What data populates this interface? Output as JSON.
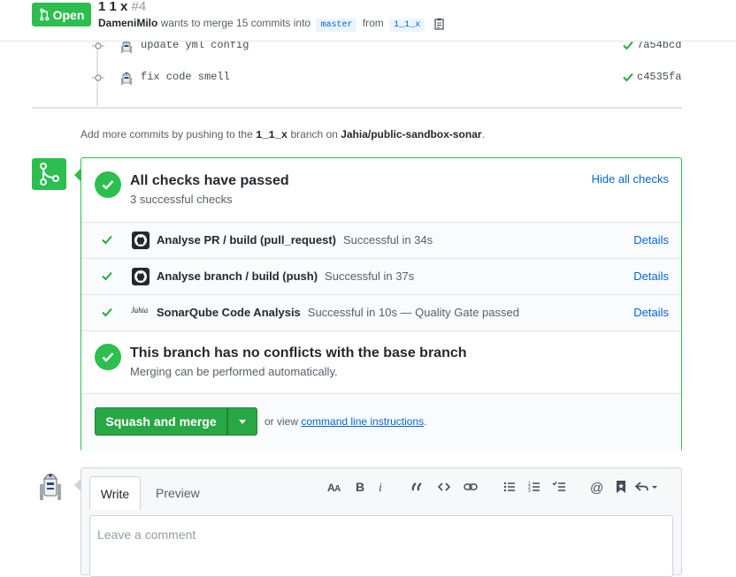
{
  "header": {
    "state": "Open",
    "title": "1 1 x",
    "number": "#4",
    "author": "DameniMilo",
    "meta_text": "wants to merge 15 commits into",
    "base_branch": "master",
    "from_text": "from",
    "head_branch": "1_1_x"
  },
  "commits": [
    {
      "message": "update yml config",
      "sha": "7a54bcd"
    },
    {
      "message": "fix code smell",
      "sha": "c4535fa"
    }
  ],
  "push_hint": {
    "prefix": "Add more commits by pushing to the",
    "branch": "1_1_x",
    "middle": "branch on",
    "repo": "Jahia/public-sandbox-sonar",
    "suffix": "."
  },
  "checks": {
    "title": "All checks have passed",
    "subtitle": "3 successful checks",
    "hide_label": "Hide all checks",
    "items": [
      {
        "name": "Analyse PR / build (pull_request)",
        "status": "Successful in 34s",
        "details": "Details",
        "icon": "github-icon"
      },
      {
        "name": "Analyse branch / build (push)",
        "status": "Successful in 37s",
        "details": "Details",
        "icon": "github-icon"
      },
      {
        "name": "SonarQube Code Analysis",
        "status": "Successful in 10s — Quality Gate passed",
        "details": "Details",
        "icon": "jahia-logo",
        "logo_text": "Jahia"
      }
    ]
  },
  "conflicts": {
    "title": "This branch has no conflicts with the base branch",
    "subtitle": "Merging can be performed automatically."
  },
  "merge": {
    "button_label": "Squash and merge",
    "or_view": "or view",
    "cli_link": "command line instructions",
    "cli_suffix": "."
  },
  "comment": {
    "tab_write": "Write",
    "tab_preview": "Preview",
    "placeholder": "Leave a comment",
    "toolbar": [
      "text-size-icon",
      "bold-icon",
      "italic-icon",
      "quote-icon",
      "code-icon",
      "link-icon",
      "bullet-list-icon",
      "numbered-list-icon",
      "task-list-icon",
      "mention-icon",
      "bookmark-icon",
      "reply-icon"
    ]
  },
  "colors": {
    "success": "#2cbe4e",
    "link": "#0366d6",
    "button": "#28a745"
  }
}
